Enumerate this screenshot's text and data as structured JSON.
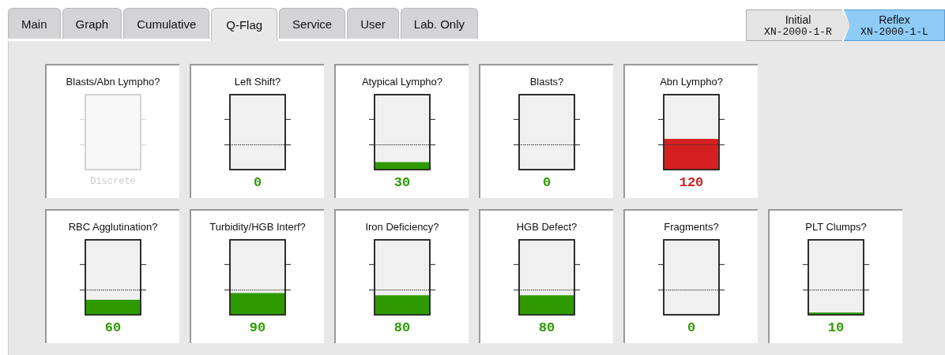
{
  "tabs": [
    {
      "label": "Main",
      "selected": false
    },
    {
      "label": "Graph",
      "selected": false
    },
    {
      "label": "Cumulative",
      "selected": false
    },
    {
      "label": "Q-Flag",
      "selected": true
    },
    {
      "label": "Service",
      "selected": false
    },
    {
      "label": "User",
      "selected": false
    },
    {
      "label": "Lab. Only",
      "selected": false
    }
  ],
  "runs": [
    {
      "label": "Initial",
      "id": "XN-2000-1-R",
      "selected": false
    },
    {
      "label": "Reflex",
      "id": "XN-2000-1-L",
      "selected": true
    }
  ],
  "flags": [
    [
      {
        "name": "Blasts/Abn Lympho?",
        "disabled": true,
        "value": "Discrete"
      },
      {
        "name": "Left Shift?",
        "disabled": false,
        "value": "0",
        "color": "#2e9a00"
      },
      {
        "name": "Atypical Lympho?",
        "disabled": false,
        "value": "30",
        "level": 0.1,
        "color": "#2e9a00"
      },
      {
        "name": "Blasts?",
        "disabled": false,
        "value": "0",
        "color": "#2e9a00"
      },
      {
        "name": "Abn Lympho?",
        "disabled": false,
        "value": "120",
        "level": 0.41,
        "color": "#d42020"
      }
    ],
    [
      {
        "name": "RBC Agglutination?",
        "disabled": false,
        "value": "60",
        "level": 0.2,
        "color": "#2e9a00"
      },
      {
        "name": "Turbidity/HGB Interf?",
        "disabled": false,
        "value": "90",
        "level": 0.29,
        "color": "#2e9a00"
      },
      {
        "name": "Iron Deficiency?",
        "disabled": false,
        "value": "80",
        "level": 0.26,
        "color": "#2e9a00"
      },
      {
        "name": "HGB Defect?",
        "disabled": false,
        "value": "80",
        "level": 0.26,
        "color": "#2e9a00"
      },
      {
        "name": "Fragments?",
        "disabled": false,
        "value": "0",
        "color": "#2e9a00"
      },
      {
        "name": "PLT Clumps?",
        "disabled": false,
        "value": "10",
        "level": 0.03,
        "color": "#2e9a00"
      }
    ]
  ]
}
